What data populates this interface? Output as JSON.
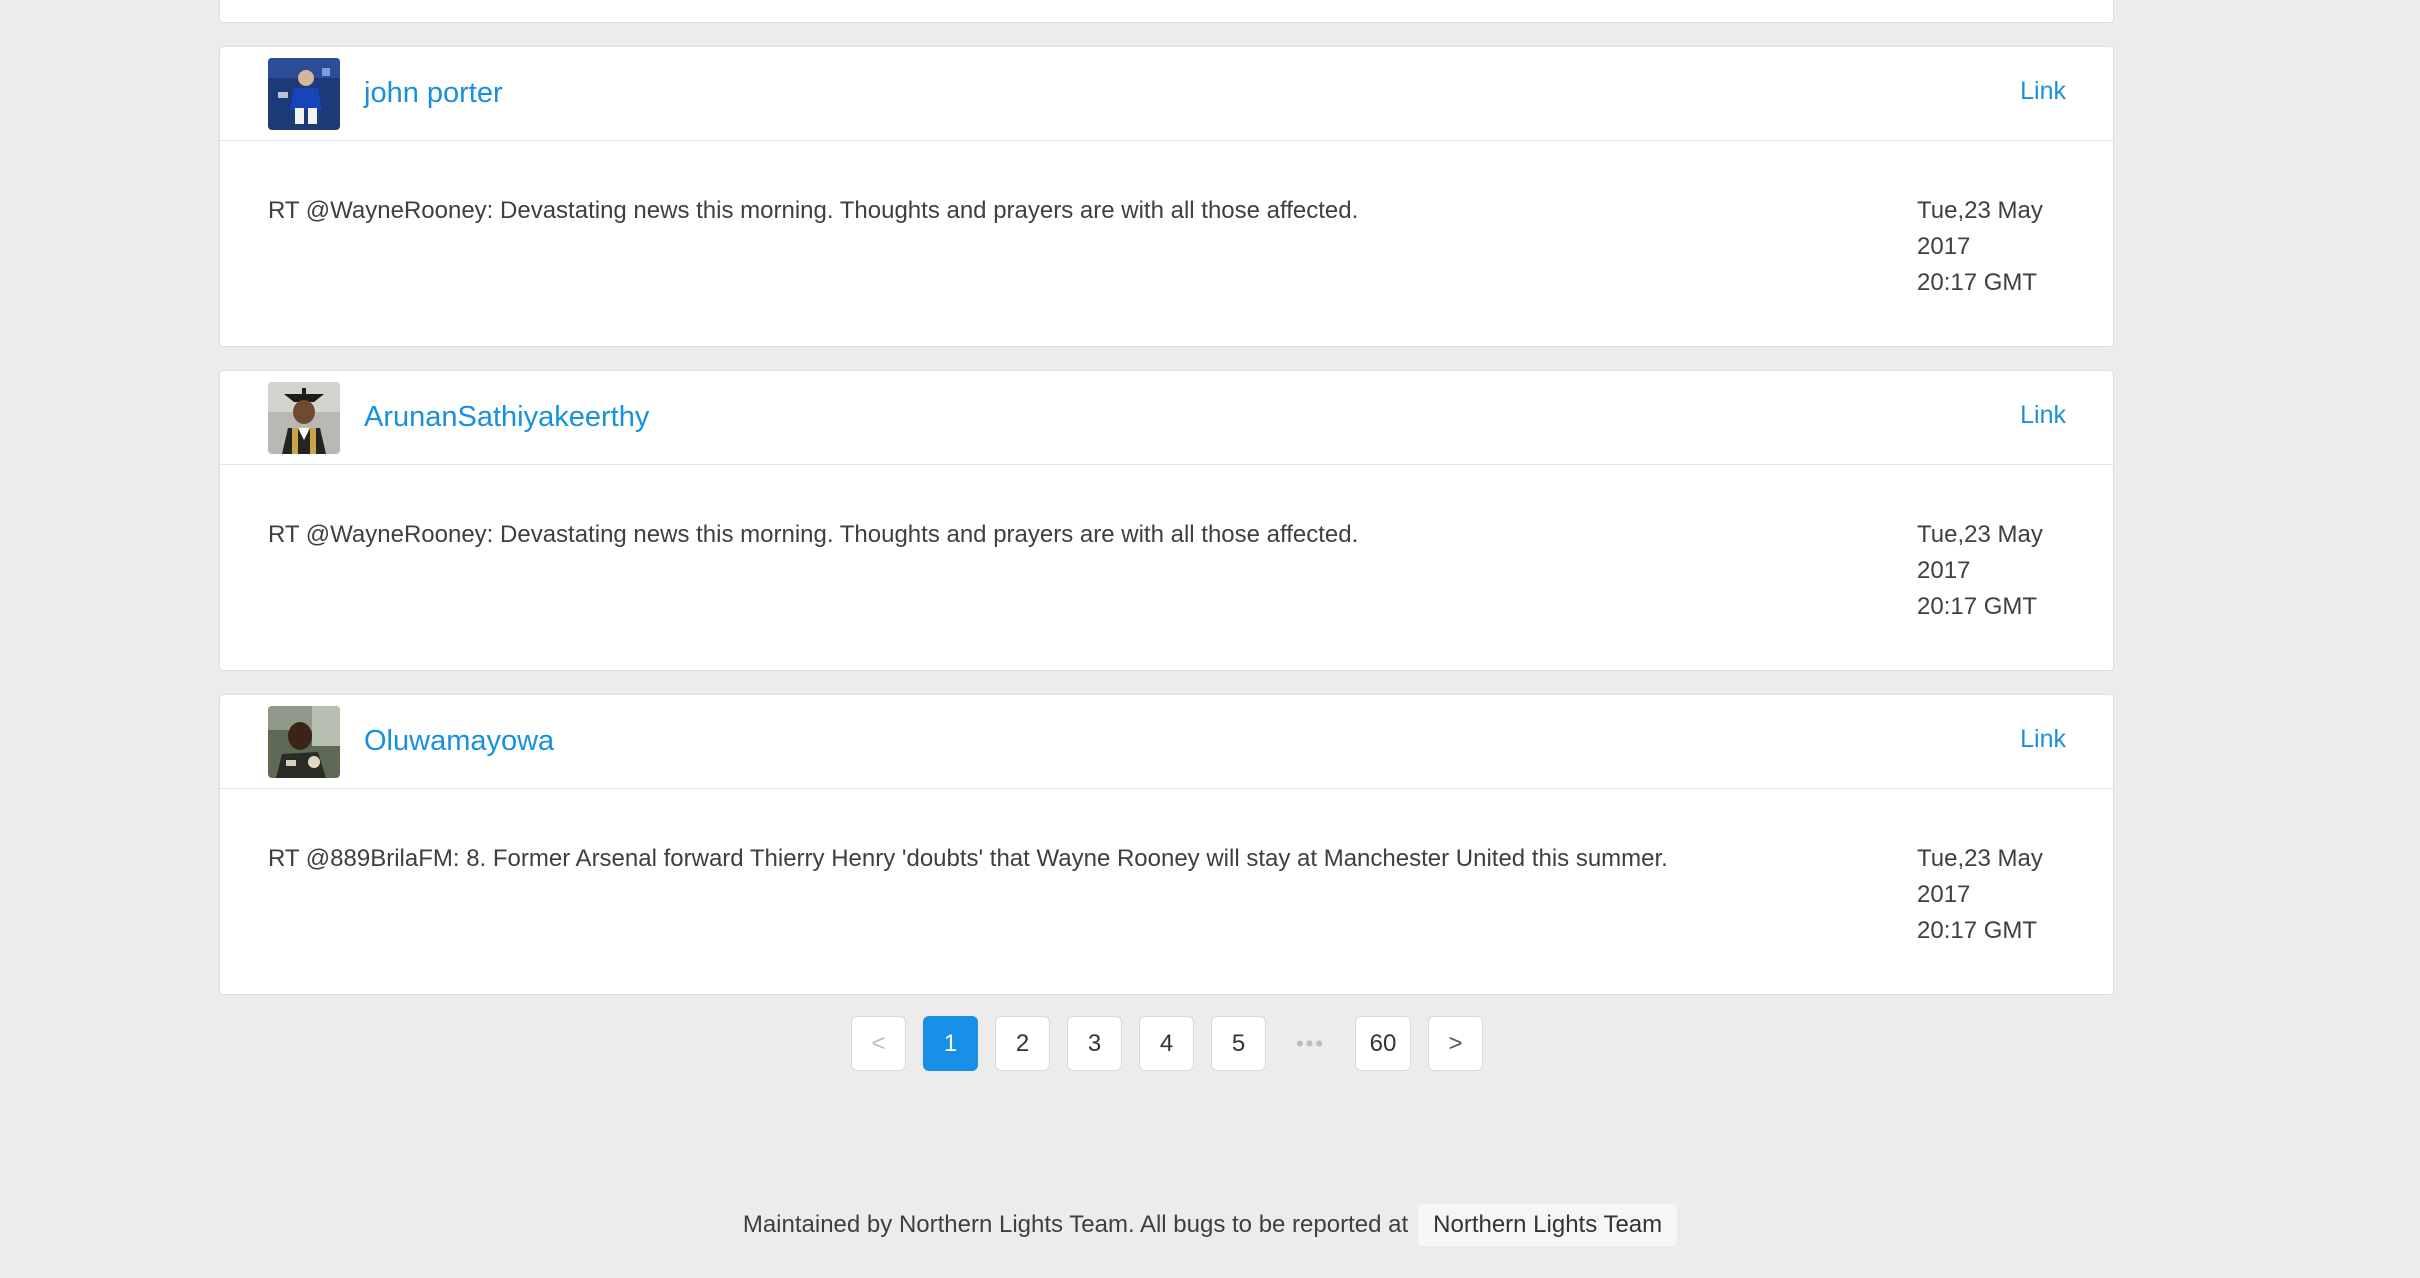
{
  "tweets": [
    {
      "user": "john porter",
      "link_label": "Link",
      "text": "RT @WayneRooney: Devastating news this morning. Thoughts and prayers are with all those affected.",
      "date_day": "Tue,23 May",
      "date_year": "2017",
      "date_time": "20:17 GMT"
    },
    {
      "user": "ArunanSathiyakeerthy",
      "link_label": "Link",
      "text": "RT @WayneRooney: Devastating news this morning. Thoughts and prayers are with all those affected.",
      "date_day": "Tue,23 May",
      "date_year": "2017",
      "date_time": "20:17 GMT"
    },
    {
      "user": "Oluwamayowa",
      "link_label": "Link",
      "text": "RT @889BrilaFM: 8. Former Arsenal forward Thierry Henry 'doubts' that Wayne Rooney will stay at Manchester United this summer.",
      "date_day": "Tue,23 May",
      "date_year": "2017",
      "date_time": "20:17 GMT"
    }
  ],
  "pagination": {
    "prev": "<",
    "pages": [
      "1",
      "2",
      "3",
      "4",
      "5"
    ],
    "current": "1",
    "ellipsis": "•••",
    "last": "60",
    "next": ">"
  },
  "footer": {
    "text": "Maintained by Northern Lights Team. All bugs to be reported at",
    "team_link": "Northern Lights Team"
  },
  "colors": {
    "accent": "#1890e8",
    "background": "#ececec",
    "card": "#ffffff"
  },
  "icons": {
    "prev": "chevron-left-icon",
    "next": "chevron-right-icon"
  }
}
